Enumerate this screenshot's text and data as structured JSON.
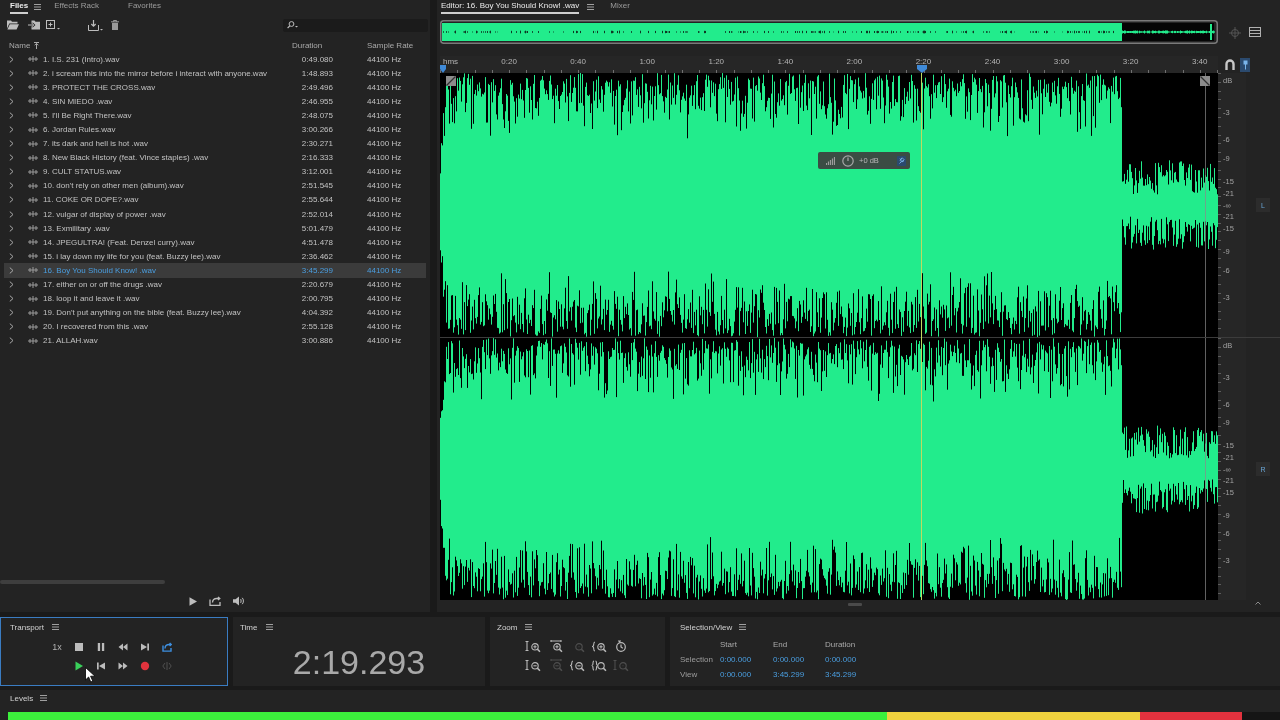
{
  "files_panel": {
    "tabs": [
      {
        "label": "Files",
        "selected": true
      },
      {
        "label": "Effects Rack",
        "selected": false
      },
      {
        "label": "Favorites",
        "selected": false
      }
    ],
    "columns": [
      "Name",
      "Duration",
      "Sample Rate"
    ],
    "rows": [
      {
        "name": "1. I.S. 231 (Intro).wav",
        "duration": "0:49.080",
        "sample_rate": "44100 Hz",
        "expanded": false,
        "selected": false
      },
      {
        "name": "2. i scream this into the mirror before i interact with anyone.wav",
        "duration": "1:48.893",
        "sample_rate": "44100 Hz",
        "expanded": false,
        "selected": false
      },
      {
        "name": "3. PROTECT THE CROSS.wav",
        "duration": "2:49.496",
        "sample_rate": "44100 Hz",
        "expanded": false,
        "selected": false
      },
      {
        "name": "4. SIN MIEDO .wav",
        "duration": "2:46.955",
        "sample_rate": "44100 Hz",
        "expanded": false,
        "selected": false
      },
      {
        "name": "5. I'll Be Right There.wav",
        "duration": "2:48.075",
        "sample_rate": "44100 Hz",
        "expanded": false,
        "selected": false
      },
      {
        "name": "6. Jordan Rules.wav",
        "duration": "3:00.266",
        "sample_rate": "44100 Hz",
        "expanded": false,
        "selected": false
      },
      {
        "name": "7. its dark and hell is hot .wav",
        "duration": "2:30.271",
        "sample_rate": "44100 Hz",
        "expanded": false,
        "selected": false
      },
      {
        "name": "8. New Black History (feat. Vince staples) .wav",
        "duration": "2:16.333",
        "sample_rate": "44100 Hz",
        "expanded": false,
        "selected": false
      },
      {
        "name": "9. CULT STATUS.wav",
        "duration": "3:12.001",
        "sample_rate": "44100 Hz",
        "expanded": false,
        "selected": false
      },
      {
        "name": "10. don't rely on other men (album).wav",
        "duration": "2:51.545",
        "sample_rate": "44100 Hz",
        "expanded": false,
        "selected": false
      },
      {
        "name": "11. COKE OR DOPE?.wav",
        "duration": "2:55.644",
        "sample_rate": "44100 Hz",
        "expanded": false,
        "selected": false
      },
      {
        "name": "12. vulgar of display of power .wav",
        "duration": "2:52.014",
        "sample_rate": "44100 Hz",
        "expanded": false,
        "selected": false
      },
      {
        "name": "13. Exmilitary .wav",
        "duration": "5:01.479",
        "sample_rate": "44100 Hz",
        "expanded": false,
        "selected": false
      },
      {
        "name": "14. JPEGULTRA! (Feat. Denzel curry).wav",
        "duration": "4:51.478",
        "sample_rate": "44100 Hz",
        "expanded": false,
        "selected": false
      },
      {
        "name": "15. i lay down my life for you (feat. Buzzy lee).wav",
        "duration": "2:36.462",
        "sample_rate": "44100 Hz",
        "expanded": false,
        "selected": false
      },
      {
        "name": "16. Boy You Should Know! .wav",
        "duration": "3:45.299",
        "sample_rate": "44100 Hz",
        "expanded": false,
        "selected": true
      },
      {
        "name": "17. either on or off the drugs .wav",
        "duration": "2:20.679",
        "sample_rate": "44100 Hz",
        "expanded": false,
        "selected": false
      },
      {
        "name": "18. loop it and leave it .wav",
        "duration": "2:00.795",
        "sample_rate": "44100 Hz",
        "expanded": false,
        "selected": false
      },
      {
        "name": "19. Don't put anything on the bible (feat. Buzzy lee).wav",
        "duration": "4:04.392",
        "sample_rate": "44100 Hz",
        "expanded": false,
        "selected": false
      },
      {
        "name": "20. I recovered from this .wav",
        "duration": "2:55.128",
        "sample_rate": "44100 Hz",
        "expanded": false,
        "selected": false
      },
      {
        "name": "21. ALLAH.wav",
        "duration": "3:00.886",
        "sample_rate": "44100 Hz",
        "expanded": false,
        "selected": false
      }
    ]
  },
  "editor": {
    "tabs": [
      {
        "label": "Editor: 16. Boy You Should Know! .wav",
        "selected": true
      },
      {
        "label": "Mixer",
        "selected": false
      }
    ],
    "ruler": [
      "hms",
      "0:20",
      "0:40",
      "1:00",
      "1:20",
      "1:40",
      "2:00",
      "2:20",
      "2:40",
      "3:00",
      "3:20",
      "3:40"
    ],
    "gain_hud": "+0 dB",
    "channels": [
      {
        "label": "L",
        "scale": [
          "dB",
          "-3",
          "-6",
          "-9",
          "-15",
          "-21",
          "-∞",
          "-21",
          "-15",
          "-9",
          "-6",
          "-3"
        ]
      },
      {
        "label": "R",
        "scale": [
          "dB",
          "-3",
          "-6",
          "-9",
          "-15",
          "-21",
          "-∞",
          "-21",
          "-15",
          "-9",
          "-6",
          "-3"
        ]
      }
    ]
  },
  "transport": {
    "title": "Transport",
    "focused": true,
    "speed": "1x",
    "buttons": [
      {
        "kind": "stop",
        "on": false,
        "disabled": false
      },
      {
        "kind": "pause",
        "on": false,
        "disabled": false
      },
      {
        "kind": "rewind",
        "on": false,
        "disabled": false
      },
      {
        "kind": "next",
        "on": false,
        "disabled": false
      },
      {
        "kind": "loop",
        "on": true,
        "disabled": false
      },
      {
        "kind": "play",
        "on": true,
        "disabled": false
      },
      {
        "kind": "previous",
        "on": false,
        "disabled": false
      },
      {
        "kind": "forward",
        "on": false,
        "disabled": false
      },
      {
        "kind": "record",
        "on": false,
        "disabled": false
      },
      {
        "kind": "skip",
        "on": false,
        "disabled": true
      }
    ]
  },
  "time": {
    "title": "Time",
    "value": "2:19.293"
  },
  "zoom": {
    "title": "Zoom",
    "buttons": [
      {
        "kind": "amplitude-in",
        "disabled": false
      },
      {
        "kind": "time-in",
        "disabled": false
      },
      {
        "kind": "point-in",
        "disabled": true
      },
      {
        "kind": "edge-in",
        "disabled": false
      },
      {
        "kind": "history",
        "disabled": false
      },
      {
        "kind": "amplitude-out",
        "disabled": false
      },
      {
        "kind": "time-out",
        "disabled": true
      },
      {
        "kind": "edge-out",
        "disabled": false
      },
      {
        "kind": "selection",
        "disabled": false
      },
      {
        "kind": "full",
        "disabled": true
      }
    ]
  },
  "selection_view": {
    "title": "Selection/View",
    "columns": [
      "Start",
      "End",
      "Duration"
    ],
    "rows": [
      {
        "label": "Selection",
        "values": [
          "0:00.000",
          "0:00.000",
          "0:00.000"
        ]
      },
      {
        "label": "View",
        "values": [
          "0:00.000",
          "3:45.299",
          "3:45.299"
        ]
      }
    ]
  },
  "levels": {
    "title": "Levels",
    "level": 0.97
  }
}
